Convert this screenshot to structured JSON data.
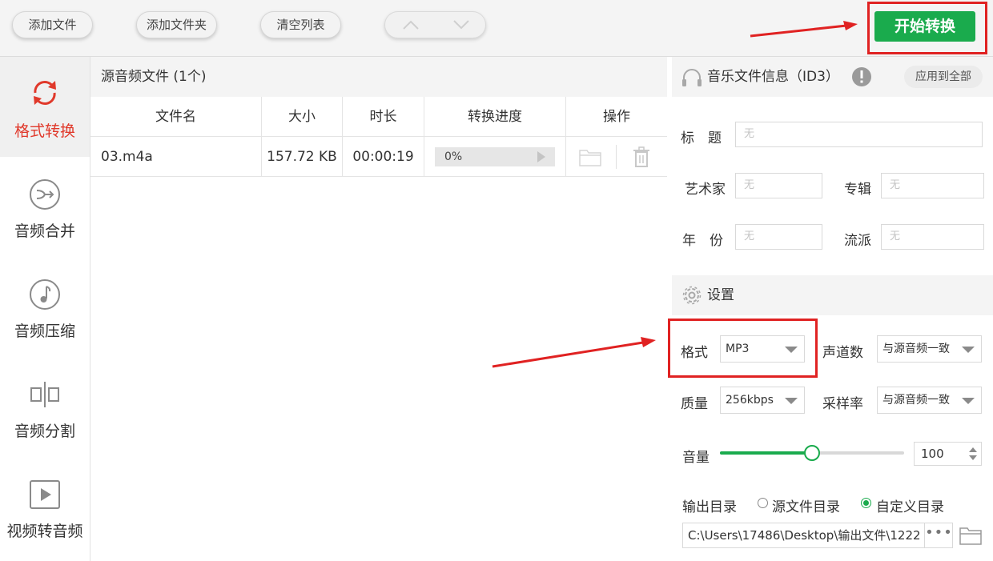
{
  "toolbar": {
    "add_file": "添加文件",
    "add_folder": "添加文件夹",
    "clear_list": "清空列表",
    "move_up_icon": "chevron-up-icon",
    "move_down_icon": "chevron-down-icon",
    "start": "开始转换"
  },
  "sidebar": {
    "items": [
      {
        "label": "格式转换",
        "icon": "refresh-icon",
        "active": true
      },
      {
        "label": "音频合并",
        "icon": "merge-icon",
        "active": false
      },
      {
        "label": "音频压缩",
        "icon": "music-note-icon",
        "active": false
      },
      {
        "label": "音频分割",
        "icon": "split-icon",
        "active": false
      },
      {
        "label": "视频转音频",
        "icon": "video-play-icon",
        "active": false
      }
    ]
  },
  "filelist": {
    "header": "源音频文件 (1个)",
    "columns": [
      "文件名",
      "大小",
      "时长",
      "转换进度",
      "操作"
    ],
    "rows": [
      {
        "name": "03.m4a",
        "size": "157.72 KB",
        "duration": "00:00:19",
        "progress": "0%",
        "progress_value": 0
      }
    ]
  },
  "id3": {
    "title": "音乐文件信息（ID3）",
    "apply_all": "应用到全部",
    "labels": {
      "title": "标　题",
      "artist": "艺术家",
      "album": "专辑",
      "year": "年　份",
      "genre": "流派"
    },
    "values": {
      "title": "无",
      "artist": "无",
      "album": "无",
      "year": "无",
      "genre": "无"
    }
  },
  "settings": {
    "title": "设置",
    "format_label": "格式",
    "format_value": "MP3",
    "channels_label": "声道数",
    "channels_value": "与源音频一致",
    "quality_label": "质量",
    "quality_value": "256kbps",
    "samplerate_label": "采样率",
    "samplerate_value": "与源音频一致",
    "volume_label": "音量",
    "volume_value": "100",
    "volume_fraction": 0.5,
    "output_label": "输出目录",
    "output_source": "源文件目录",
    "output_custom": "自定义目录",
    "output_path": "C:\\Users\\17486\\Desktop\\输出文件\\1222",
    "browse_dots": "•••"
  },
  "colors": {
    "accent": "#1aab4d",
    "active_sidebar_text": "#e0392b",
    "annotation_red": "#e02222"
  }
}
